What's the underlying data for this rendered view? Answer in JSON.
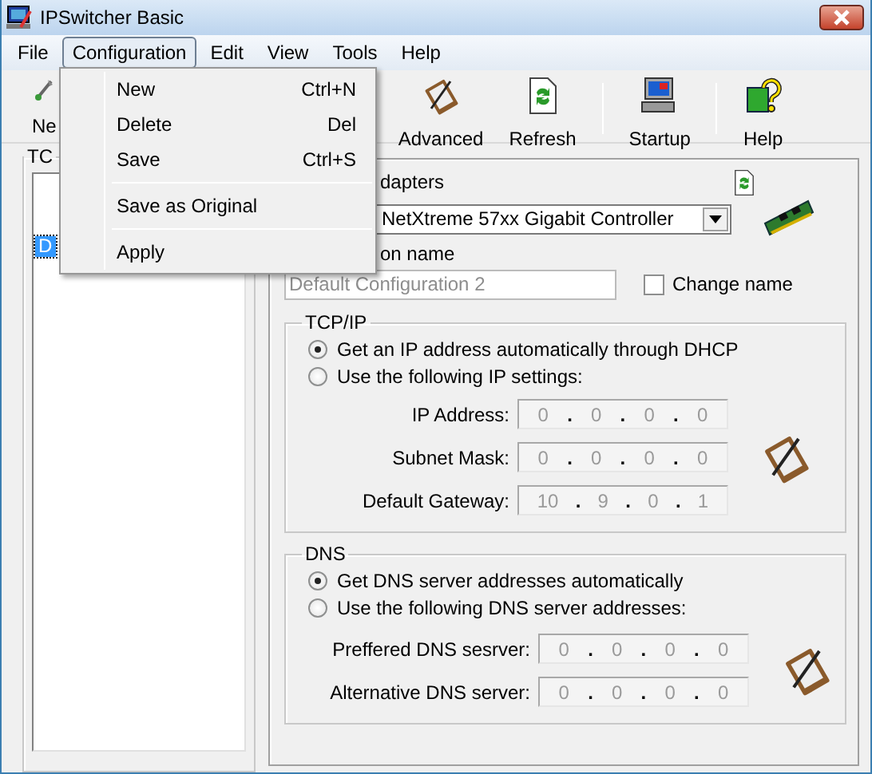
{
  "window": {
    "title": "IPSwitcher Basic"
  },
  "menu_bar": [
    {
      "label": "File",
      "selected": false
    },
    {
      "label": "Configuration",
      "selected": true
    },
    {
      "label": "Edit",
      "selected": false
    },
    {
      "label": "View",
      "selected": false
    },
    {
      "label": "Tools",
      "selected": false
    },
    {
      "label": "Help",
      "selected": false
    }
  ],
  "open_menu": [
    {
      "kind": "item",
      "label": "New",
      "shortcut": "Ctrl+N"
    },
    {
      "kind": "item",
      "label": "Delete",
      "shortcut": "Del"
    },
    {
      "kind": "item",
      "label": "Save",
      "shortcut": "Ctrl+S"
    },
    {
      "kind": "separator"
    },
    {
      "kind": "item",
      "label": "Save as Original"
    },
    {
      "kind": "separator"
    },
    {
      "kind": "item",
      "label": "Apply"
    }
  ],
  "toolbar": [
    {
      "kind": "button",
      "label": "Ne"
    },
    {
      "kind": "button",
      "label": "Advanced"
    },
    {
      "kind": "button",
      "label": "Refresh"
    },
    {
      "kind": "separator"
    },
    {
      "kind": "button",
      "label": "Startup"
    },
    {
      "kind": "separator"
    },
    {
      "kind": "button",
      "label": "Help"
    }
  ],
  "left_panel": {
    "group_label": "TC",
    "list_items": [
      {
        "label": "D",
        "selected": true
      }
    ]
  },
  "adapters": {
    "label": "dapters",
    "value": "NetXtreme 57xx Gigabit Controller"
  },
  "configuration_name": {
    "label": "on name",
    "value": "Default Configuration 2",
    "disabled": true,
    "change_name": {
      "label": "Change name",
      "checked": false
    }
  },
  "tcpip": {
    "title": "TCP/IP",
    "options": [
      {
        "label": "Get an IP address automatically through DHCP",
        "selected": true
      },
      {
        "label": "Use the following IP settings:",
        "selected": false
      }
    ],
    "fields": [
      {
        "label": "IP Address:",
        "octets": [
          "0",
          "0",
          "0",
          "0"
        ],
        "separator": ".",
        "disabled": true
      },
      {
        "label": "Subnet Mask:",
        "octets": [
          "0",
          "0",
          "0",
          "0"
        ],
        "separator": ".",
        "disabled": true
      },
      {
        "label": "Default Gateway:",
        "octets": [
          "10",
          "9",
          "0",
          "1"
        ],
        "separator": ".",
        "disabled": true
      }
    ]
  },
  "dns": {
    "title": "DNS",
    "options": [
      {
        "label": "Get DNS server addresses automatically",
        "selected": true
      },
      {
        "label": "Use the following DNS server addresses:",
        "selected": false
      }
    ],
    "fields": [
      {
        "label": "Preffered DNS sesrver:",
        "octets": [
          "0",
          "0",
          "0",
          "0"
        ],
        "separator": ".",
        "disabled": true
      },
      {
        "label": "Alternative DNS server:",
        "octets": [
          "0",
          "0",
          "0",
          "0"
        ],
        "separator": ".",
        "disabled": true
      }
    ]
  }
}
